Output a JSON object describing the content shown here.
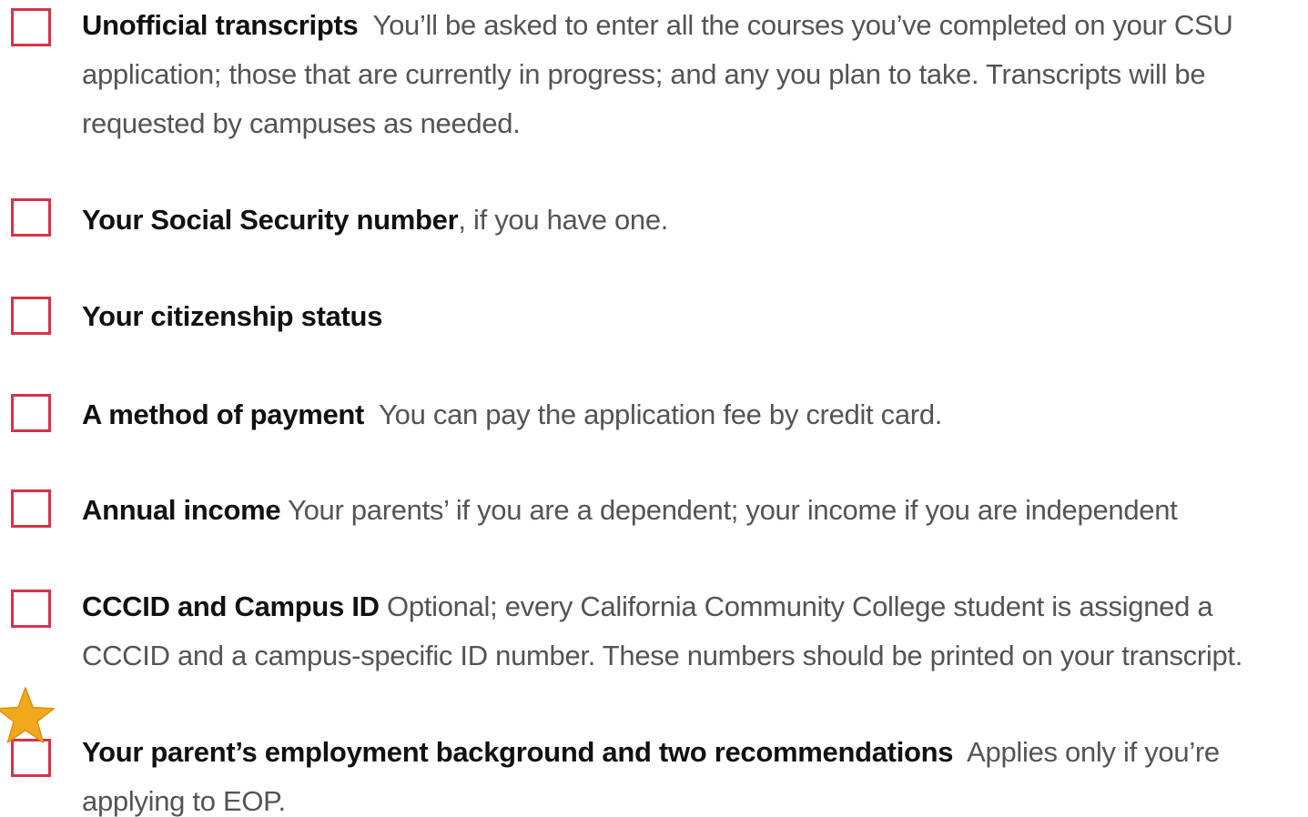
{
  "checklist": {
    "items": [
      {
        "title": "Unofficial transcripts",
        "separator": "  ",
        "description": "You’ll be asked to enter all the courses you’ve completed on your CSU application; those that are currently in progress; and any you plan to take. Transcripts will be requested by campuses as needed."
      },
      {
        "title": "Your Social Security number",
        "separator": "",
        "description": ", if you have one."
      },
      {
        "title": "Your citizenship status",
        "separator": "",
        "description": ""
      },
      {
        "title": "A method of payment",
        "separator": "  ",
        "description": "You can pay the application fee by credit card."
      },
      {
        "title": "Annual income",
        "separator": " ",
        "description": "Your parents’ if you are a dependent; your income if you are independent"
      },
      {
        "title": "CCCID and Campus ID",
        "separator": " ",
        "description": "Optional; every California Community College student is assigned a CCCID and a campus-specific ID number. These numbers should be printed on your transcript."
      },
      {
        "title": "Your parent’s employment background and two recommendations",
        "separator": "  ",
        "description": "Applies only if you’re applying to EOP."
      }
    ],
    "checkbox_color": "#d6334a",
    "star_icon": "star-icon",
    "star_color": "#f2a81d"
  }
}
